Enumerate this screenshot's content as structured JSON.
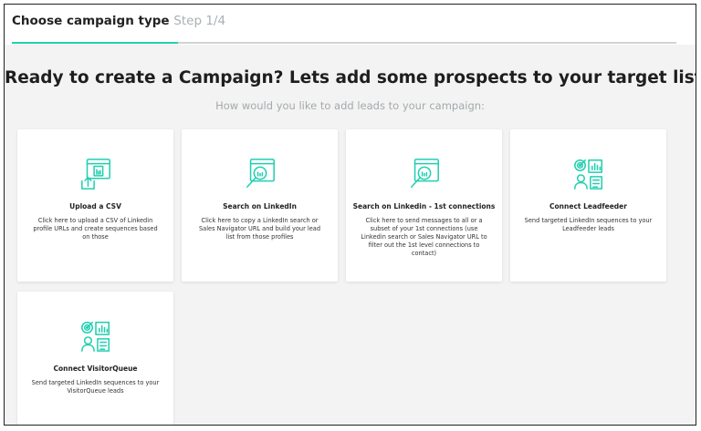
{
  "header": {
    "title": "Choose campaign type",
    "step": "Step 1/4",
    "progress_fraction": 0.25,
    "accent": "#21cfb0"
  },
  "main": {
    "headline": "Ready to create a Campaign? Lets add some prospects to your target list!",
    "subheadline": "How would you like to add leads to your campaign:"
  },
  "cards": [
    {
      "title": "Upload a CSV",
      "description": "Click here to upload a CSV of Linkedin profile URLs and create sequences based on those",
      "icon": "upload-csv-icon"
    },
    {
      "title": "Search on LinkedIn",
      "description": "Click here to copy a LinkedIn search or Sales Navigator URL and build your lead list from those profiles",
      "icon": "linkedin-search-icon"
    },
    {
      "title": "Search on Linkedin - 1st connections",
      "description": "Click here to send messages to all or a subset of your 1st connections (use Linkedin search or Sales Navigator URL to filter out the 1st level connections to contact)",
      "icon": "linkedin-connections-search-icon"
    },
    {
      "title": "Connect Leadfeeder",
      "description": "Send targeted LinkedIn sequences to your Leadfeeder leads",
      "icon": "leadfeeder-icon"
    },
    {
      "title": "Connect VisitorQueue",
      "description": "Send targeted LinkedIn sequences to your VisitorQueue leads",
      "icon": "visitorqueue-icon"
    }
  ]
}
